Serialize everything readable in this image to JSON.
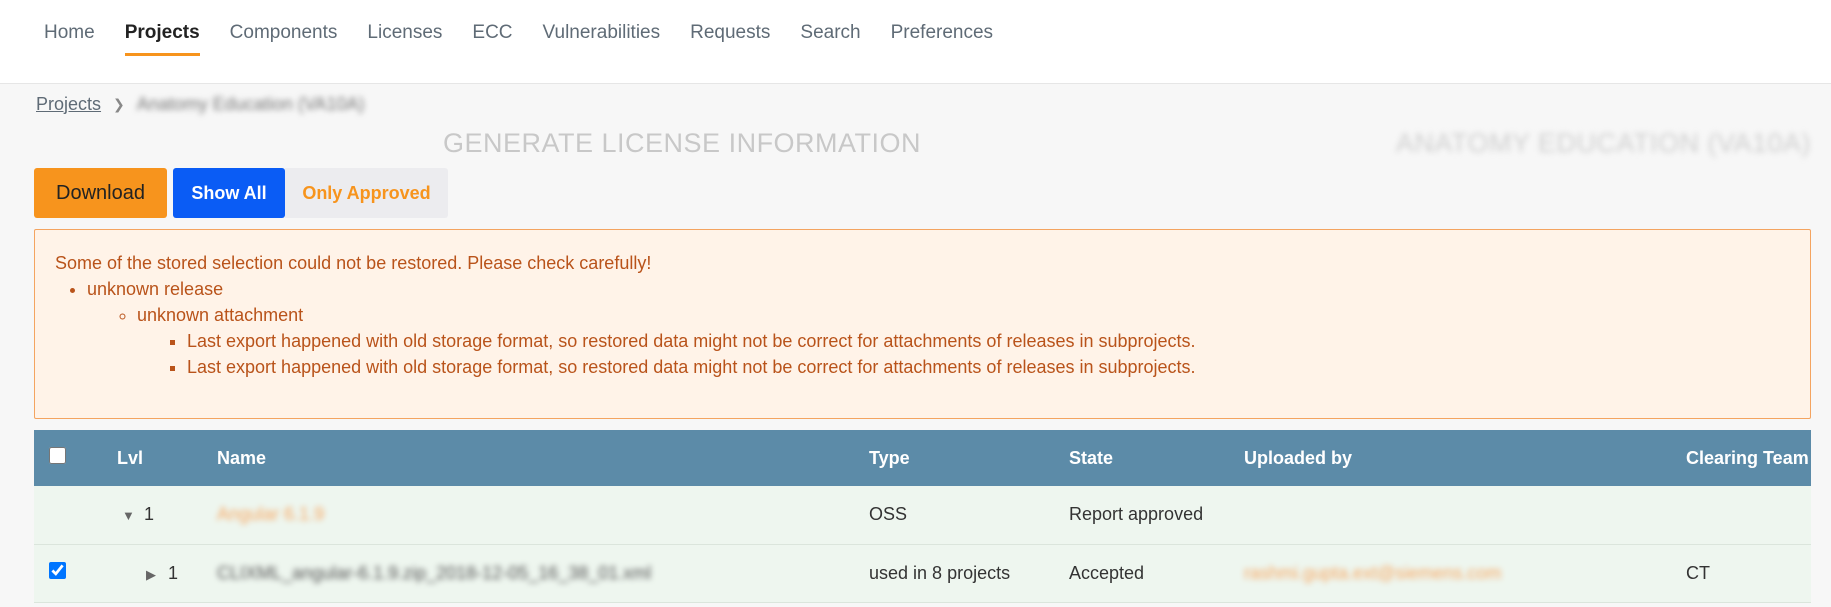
{
  "nav": {
    "items": [
      {
        "label": "Home",
        "active": false
      },
      {
        "label": "Projects",
        "active": true
      },
      {
        "label": "Components",
        "active": false
      },
      {
        "label": "Licenses",
        "active": false
      },
      {
        "label": "ECC",
        "active": false
      },
      {
        "label": "Vulnerabilities",
        "active": false
      },
      {
        "label": "Requests",
        "active": false
      },
      {
        "label": "Search",
        "active": false
      },
      {
        "label": "Preferences",
        "active": false
      }
    ]
  },
  "breadcrumb": {
    "root": "Projects",
    "current": "Anatomy Education (VA10A)"
  },
  "header": {
    "title": "GENERATE LICENSE INFORMATION",
    "project": "ANATOMY EDUCATION (VA10A)"
  },
  "buttons": {
    "download": "Download",
    "show_all": "Show All",
    "only_approved": "Only Approved"
  },
  "alert": {
    "heading": "Some of the stored selection could not be restored. Please check carefully!",
    "release": "unknown release",
    "attachment": "unknown attachment",
    "details": [
      "Last export happened with old storage format, so restored data might not be correct for attachments of releases in subprojects.",
      "Last export happened with old storage format, so restored data might not be correct for attachments of releases in subprojects."
    ]
  },
  "table": {
    "headers": {
      "lvl": "Lvl",
      "name": "Name",
      "type": "Type",
      "state": "State",
      "uploaded_by": "Uploaded by",
      "clearing_team": "Clearing Team"
    },
    "rows": [
      {
        "checked": null,
        "expander": "▼",
        "lvl": "1",
        "name": "Angular 6.1.9",
        "type": "OSS",
        "state": "Report approved",
        "uploaded_by": "",
        "clearing_team": ""
      },
      {
        "checked": true,
        "expander": "▶",
        "lvl": "1",
        "name": "CLIXML_angular-6.1.9.zip_2018-12-05_16_38_01.xml",
        "type_prefix": "used in ",
        "type_count": "8",
        "type_suffix": " projects",
        "state": "Accepted",
        "uploaded_by": "rashmi.gupta.ext@siemens.com",
        "clearing_team": "CT"
      }
    ]
  },
  "colors": {
    "accent": "#f7941d",
    "primary": "#0a5cf5",
    "table_header": "#5c8ba8",
    "row_bg": "#eef6ef",
    "alert_text": "#b9531a"
  }
}
